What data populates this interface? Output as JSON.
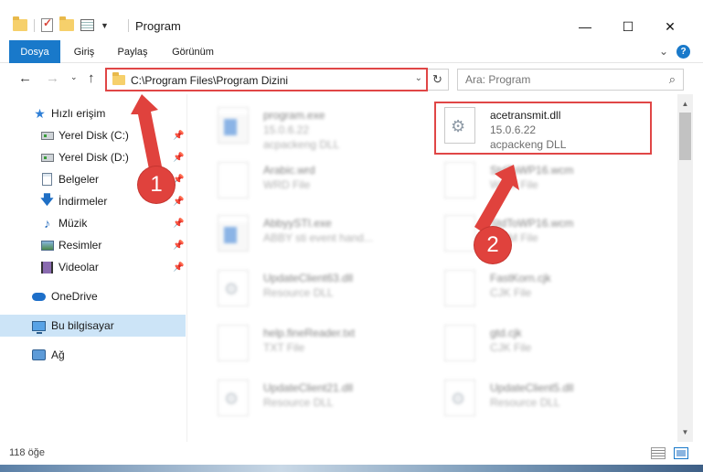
{
  "window": {
    "title": "Program",
    "controls": {
      "minimize": "—",
      "maximize": "☐",
      "close": "✕"
    }
  },
  "ribbon": {
    "tabs": [
      {
        "label": "Dosya",
        "active": true
      },
      {
        "label": "Giriş"
      },
      {
        "label": "Paylaş"
      },
      {
        "label": "Görünüm"
      }
    ],
    "help": "?"
  },
  "nav": {
    "address_path": "C:\\Program Files\\Program Dizini",
    "search_placeholder": "Ara: Program"
  },
  "sidebar": {
    "items": [
      {
        "label": "Hızlı erişim",
        "icon": "star-icon"
      },
      {
        "label": "Yerel Disk (C:)",
        "icon": "drive-icon",
        "pinned": true
      },
      {
        "label": "Yerel Disk (D:)",
        "icon": "drive-icon",
        "pinned": true
      },
      {
        "label": "Belgeler",
        "icon": "documents-icon",
        "pinned": true
      },
      {
        "label": "İndirmeler",
        "icon": "downloads-icon",
        "pinned": true
      },
      {
        "label": "Müzik",
        "icon": "music-icon",
        "pinned": true
      },
      {
        "label": "Resimler",
        "icon": "pictures-icon",
        "pinned": true
      },
      {
        "label": "Videolar",
        "icon": "videos-icon",
        "pinned": true
      },
      {
        "label": "OneDrive",
        "icon": "onedrive-icon"
      },
      {
        "label": "Bu bilgisayar",
        "icon": "this-pc-icon",
        "selected": true
      },
      {
        "label": "Ağ",
        "icon": "network-icon"
      }
    ]
  },
  "files": {
    "left_column": [
      {
        "name": "program.exe",
        "line2": "15.0.6.22",
        "line3": "acpackeng DLL"
      },
      {
        "name": "Arabic.wrd",
        "line2": "WRD File"
      },
      {
        "name": "AbbyySTI.exe",
        "line2": "ABBY sti event hand..."
      },
      {
        "name": "UpdateClient63.dll",
        "line2": "Resource DLL"
      },
      {
        "name": "help.fineReader.txt",
        "line2": "TXT File"
      },
      {
        "name": "UpdateClient21.dll",
        "line2": "Resource DLL"
      }
    ],
    "right_column": [
      {
        "name": "acetransmit.dll",
        "line2": "15.0.6.22",
        "line3": "acpackeng DLL",
        "highlighted": true
      },
      {
        "name": "StdToWP16.wcm",
        "line2": "WCM File"
      },
      {
        "name": "StdToWP16.wcm",
        "line2": "WCM File"
      },
      {
        "name": "FastKorn.cjk",
        "line2": "CJK File"
      },
      {
        "name": "gtd.cjk",
        "line2": "CJK File"
      },
      {
        "name": "UpdateClient5.dll",
        "line2": "Resource DLL"
      }
    ]
  },
  "status": {
    "item_count": "118 öğe"
  },
  "callouts": {
    "one": "1",
    "two": "2"
  },
  "colors": {
    "accent": "#1979ca",
    "highlight": "#e04646",
    "selection": "#cce4f7"
  }
}
